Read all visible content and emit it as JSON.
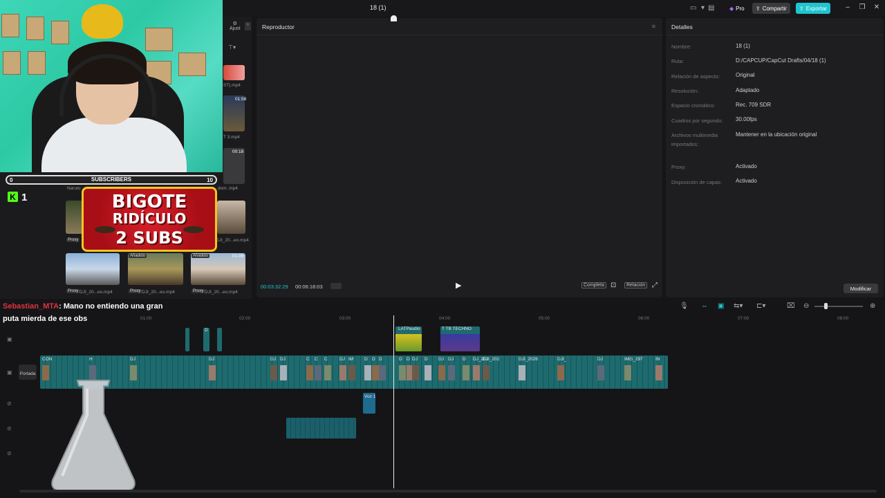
{
  "window": {
    "title": "18 (1)",
    "pro_label": "Pro",
    "share_label": "Compartir",
    "export_label": "Exportar"
  },
  "media_panel": {
    "adjust_label": "Ajust",
    "thumbnails": [
      {
        "label": "ST).mp4",
        "duration": ""
      },
      {
        "label": "T 3.mp4",
        "duration": "01:58"
      },
      {
        "label": "",
        "duration": "00:18"
      },
      {
        "label": "Naruto",
        "duration": ""
      },
      {
        "label": "dom .mp4",
        "duration": ""
      },
      {
        "label": "DJI_20...eo.mp4",
        "tag": "Proxy"
      },
      {
        "label": "DJI_20...eo.mp4",
        "tag": ""
      },
      {
        "label": "DJI_20...eo.mp4",
        "tag": "Proxy"
      },
      {
        "label": "DJI_20...eo.mp4",
        "tag": "Proxy"
      },
      {
        "label": "DJI_20...eo.mp4",
        "tag": "Proxy",
        "badge": "Añadido"
      },
      {
        "label": "DJI_20...eo.mp4",
        "tag": "Proxy",
        "badge": "Añadido",
        "duration": "01:06"
      }
    ]
  },
  "player": {
    "title": "Reproductor",
    "current_time": "00:03:32:29",
    "total_time": "00:06:18:03",
    "full_label": "Completa",
    "ratio_label": "Relación"
  },
  "details": {
    "title": "Detalles",
    "rows": [
      {
        "key": "Nombre:",
        "value": "18 (1)"
      },
      {
        "key": "Ruta:",
        "value": "D:/CAPCUP/CapCut Drafts/04/18 (1)"
      },
      {
        "key": "Relación de aspecto:",
        "value": "Original"
      },
      {
        "key": "Resolución:",
        "value": "Adaptado"
      },
      {
        "key": "Espacio cromático:",
        "value": "Rec. 709 SDR"
      },
      {
        "key": "Cuadros por segundo:",
        "value": "30.00fps"
      },
      {
        "key": "Archivos multimedia importados:",
        "value": "Mantener en la ubicación original"
      },
      {
        "key": "Proxy:",
        "value": "Activado"
      },
      {
        "key": "Disposición de capas:",
        "value": "Activado"
      }
    ],
    "modify_label": "Modificar"
  },
  "overlay": {
    "subscribers_label": "SUBSCRIBERS",
    "sub_min": "0",
    "sub_max": "10",
    "kick_letter": "K",
    "kick_count": "1",
    "goal_line1": "BIGOTE",
    "goal_line2": "RIDÍCULO",
    "goal_line3": "2 SUBS"
  },
  "chat": {
    "user": "Sebastian_MTA",
    "message": ": Mano no entiendo una gran puta mierda de ese obs"
  },
  "timeline": {
    "ruler": [
      "01:00",
      "02:00",
      "03:00",
      "04:00",
      "05:00",
      "06:00",
      "07:00",
      "08:00"
    ],
    "cover_label": "Portada",
    "top_clips": [
      {
        "label": "D"
      },
      {
        "label": "LATPaudio"
      },
      {
        "label": "T TB TECHNO"
      }
    ],
    "main_clip_labels": [
      "CON",
      "H",
      "DJ",
      "DJ",
      "DJ",
      "DJ",
      "C",
      "C",
      "C",
      "DJ",
      "IM",
      "D",
      "D",
      "D",
      "D",
      "D",
      "DJ",
      "D",
      "DJ",
      "DJ",
      "D",
      "DJ_202",
      "DJI_202",
      "DJI_2026",
      "DJI_",
      "DJ",
      "IMG_297",
      "IN"
    ],
    "voice_clip": "Voz 1"
  }
}
